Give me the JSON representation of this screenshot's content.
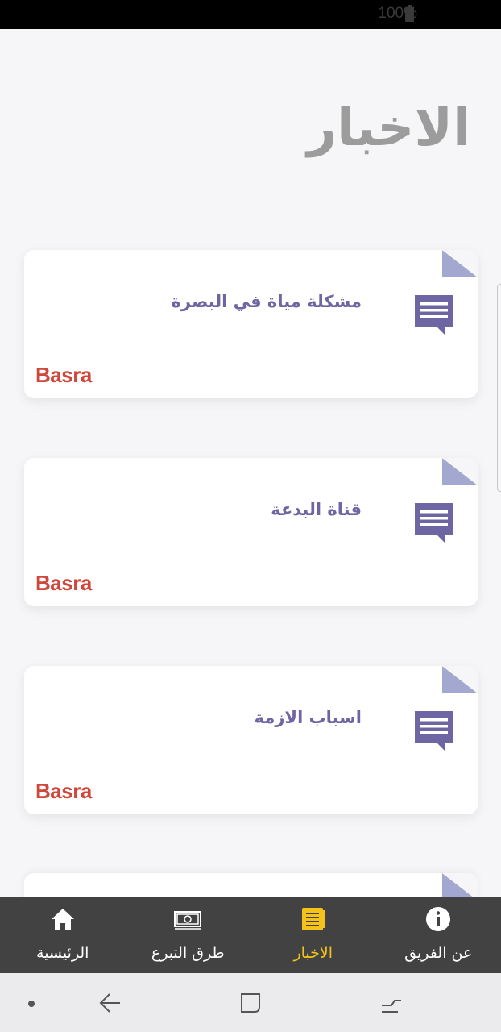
{
  "status_bar": {
    "battery_text": "100%"
  },
  "page": {
    "title": "الاخبار"
  },
  "news": [
    {
      "headline": "مشكلة مياة في البصرة",
      "location": "Basra",
      "icon": "chat-icon"
    },
    {
      "headline": "قناة البدعة",
      "location": "Basra",
      "icon": "chat-icon"
    },
    {
      "headline": "اسباب الازمة",
      "location": "Basra",
      "icon": "chat-icon"
    }
  ],
  "bottom_nav": {
    "items": [
      {
        "label": "عن الفريق",
        "icon": "info-icon",
        "active": false
      },
      {
        "label": "الاخبار",
        "icon": "news-icon",
        "active": true
      },
      {
        "label": "طرق التبرع",
        "icon": "money-icon",
        "active": false
      },
      {
        "label": "الرئيسية",
        "icon": "home-icon",
        "active": false
      }
    ]
  },
  "colors": {
    "accent": "#f3c21b",
    "headline": "#6e66a3",
    "location": "#d0473b",
    "fold": "#a2a8cf",
    "nav_bg": "#424242",
    "title": "#9c9c9c"
  }
}
